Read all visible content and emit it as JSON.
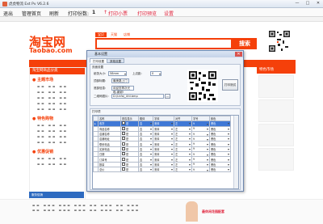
{
  "window": {
    "title": "虎虎物流 Ext Pv V6.2.6",
    "min": "—",
    "max": "□",
    "close": "✕"
  },
  "menubar": {
    "items": [
      "退出",
      "管理首页",
      "刷新",
      "打印份数:"
    ],
    "copies": "1",
    "print_red": "打印小票",
    "preview": "打印预览",
    "settings": "设置"
  },
  "page": {
    "logo_cn": "淘宝网",
    "logo_en": "Taobao.com",
    "search_tabs": [
      "宝贝",
      "天猫",
      "店铺"
    ],
    "search_button": "搜索",
    "cat_header": "淘宝网商品分类",
    "cat_groups": [
      {
        "title": "主题市场"
      },
      {
        "title": "特色购物"
      },
      {
        "title": "优惠促销"
      }
    ],
    "right_header": "特色市场",
    "footer_link": "服务促销"
  },
  "dialog": {
    "title": "基本设置",
    "close": "✕",
    "tabs": [
      "打印设置",
      "其他设置"
    ],
    "page_group": "页面设置",
    "paper_label": "纸张大小:",
    "paper_value": "58mm",
    "top_label": "上边距:",
    "top_value": "0",
    "qty_label": "顶部标题:",
    "qty_value": "最美路上门",
    "footer_label": "底部信息:",
    "footer_value": "欢迎您再次光临,谢谢!",
    "img_label": "二维码图片:",
    "img_value": "D:\\Ucfa\\_Util.bmp",
    "browse": "...",
    "print_test": "打印测试",
    "items_group": "打印项",
    "columns": [
      "名称",
      "是否显示",
      "粗体",
      "字体",
      "对齐",
      "字号",
      "颜色"
    ],
    "rows": [
      [
        "收货",
        "是",
        "否",
        "宋体",
        "左",
        "9",
        "黑色"
      ],
      [
        "商品名称",
        "是",
        "否",
        "宋体",
        "左",
        "9",
        "黑色"
      ],
      [
        "店铺名称",
        "是",
        "否",
        "宋体",
        "左",
        "9",
        "黑色"
      ],
      [
        "店铺地址",
        "是",
        "否",
        "宋体",
        "左",
        "9",
        "黑色"
      ],
      [
        "联系电话",
        "是",
        "否",
        "宋体",
        "左",
        "9",
        "黑色"
      ],
      [
        "买家电话",
        "是",
        "否",
        "宋体",
        "左",
        "9",
        "黑色"
      ],
      [
        "日期",
        "是",
        "否",
        "宋体",
        "左",
        "9",
        "黑色"
      ],
      [
        "订单号",
        "是",
        "否",
        "宋体",
        "左",
        "9",
        "黑色"
      ],
      [
        "数量",
        "是",
        "否",
        "宋体",
        "左",
        "9",
        "黑色"
      ],
      [
        "总价",
        "是",
        "否",
        "宋体",
        "左",
        "9",
        "黑色"
      ]
    ],
    "selected_row": 0
  },
  "colors": {
    "taobao_orange": "#f5400a",
    "menu_red": "#e0223b",
    "selection_blue": "#3f78d6"
  },
  "footer_banner": "最休闲花园配套"
}
